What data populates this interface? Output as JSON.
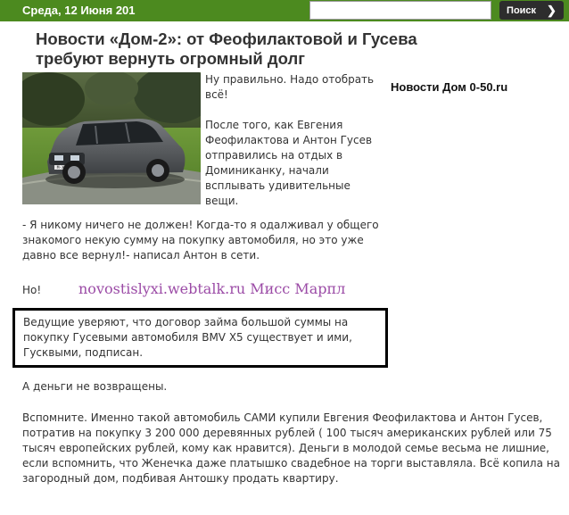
{
  "topbar": {
    "date": "Среда, 12 Июня 201",
    "search_value": "",
    "search_button": "Поиск",
    "search_button_icon": "chevron-right-icon",
    "bg_color": "#4c8a1f"
  },
  "article": {
    "title": "Новости «Дом-2»: от Феофилактовой и Гусева требуют вернуть огромный долг",
    "photo_icon": "car-photo",
    "photo_plate": "M·XV 4263",
    "side_note": "Новости Дом 0-50.ru",
    "intro": [
      "Ну правильно. Надо отобрать всё!",
      "После того, как Евгения Феофилактова и Антон Гусев отправились на отдых в Доминиканку, начали всплывать удивительные вещи."
    ],
    "para1": "- Я никому ничего не должен! Когда-то я одалживал у общего знакомого некую сумму на покупку автомобиля, но это уже давно все вернул!- написал Антон в сети.",
    "para2": "Но!",
    "watermark": "novostislyxi.webtalk.ru  Мисс Марпл",
    "boxed": "Ведущие уверяют, что договор займа большой суммы на покупку Гусевыми автомобиля BMV X5 существует и ими, Гусквыми, подписан.",
    "para3": "А деньги не возвращены.",
    "para4": "Вспомните. Именно такой автомобиль САМИ купили Евгения Феофилактова и Антон Гусев, потратив на покупку  3 200 000 деревянных рублей ( 100 тысяч американских рублей или 75 тысяч европейских рублей, кому как нравится). Деньги в молодой семье весьма не лишние, если вспомнить, что Женечка даже платышко свадебное на торги выставляла. Всё копила на загородный дом, подбивая Антошку продать квартиру."
  }
}
